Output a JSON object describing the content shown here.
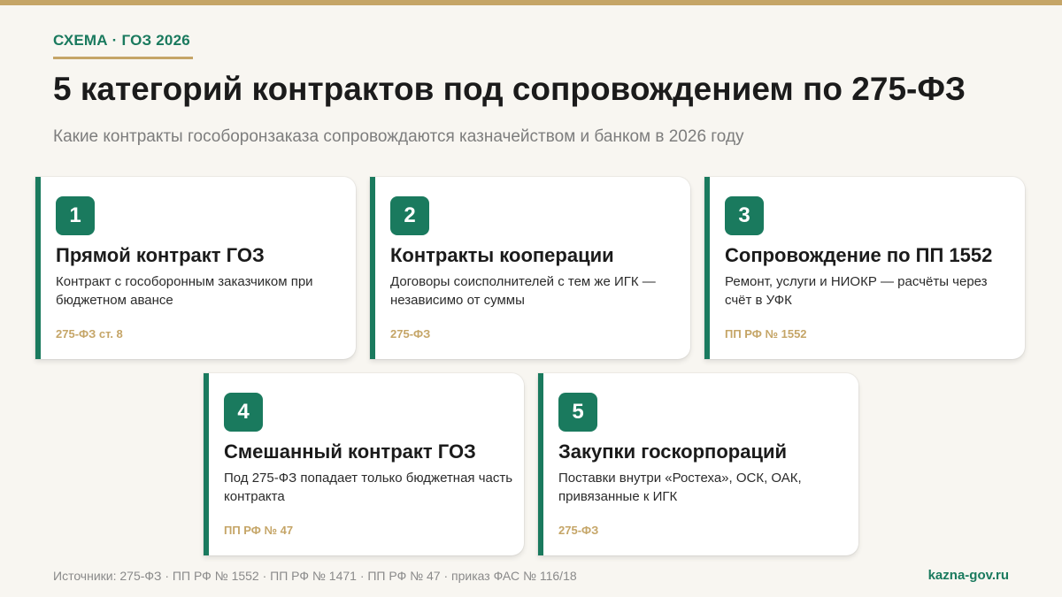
{
  "header": {
    "kicker": "СХЕМА · ГОЗ 2026",
    "title": "5 категорий контрактов под сопровождением по 275-ФЗ",
    "subtitle": "Какие контракты гособоронзаказа сопровождаются казначейством и банком в 2026 году"
  },
  "cards": [
    {
      "number": "1",
      "title": "Прямой контракт ГОЗ",
      "description": "Контракт с гособоронным заказчиком при бюджетном авансе",
      "reference": "275-ФЗ ст. 8"
    },
    {
      "number": "2",
      "title": "Контракты кооперации",
      "description": "Договоры соисполнителей с тем же ИГК — независимо от суммы",
      "reference": "275-ФЗ"
    },
    {
      "number": "3",
      "title": "Сопровождение по ПП 1552",
      "description": "Ремонт, услуги и НИОКР — расчёты через счёт в УФК",
      "reference": "ПП РФ № 1552"
    },
    {
      "number": "4",
      "title": "Смешанный контракт ГОЗ",
      "description": "Под 275-ФЗ попадает только бюджетная часть контракта",
      "reference": "ПП РФ № 47"
    },
    {
      "number": "5",
      "title": "Закупки госкорпораций",
      "description": "Поставки внутри «Ростеха», ОСК, ОАК, привязанные к ИГК",
      "reference": "275-ФЗ"
    }
  ],
  "footer": {
    "sources": "Источники: 275-ФЗ · ПП РФ № 1552 · ПП РФ № 1471 · ПП РФ № 47 · приказ ФАС № 116/18",
    "site": "kazna-gov.ru"
  },
  "colors": {
    "accent_green": "#1a7a5e",
    "accent_gold": "#c5a567",
    "background": "#f8f6f1"
  }
}
